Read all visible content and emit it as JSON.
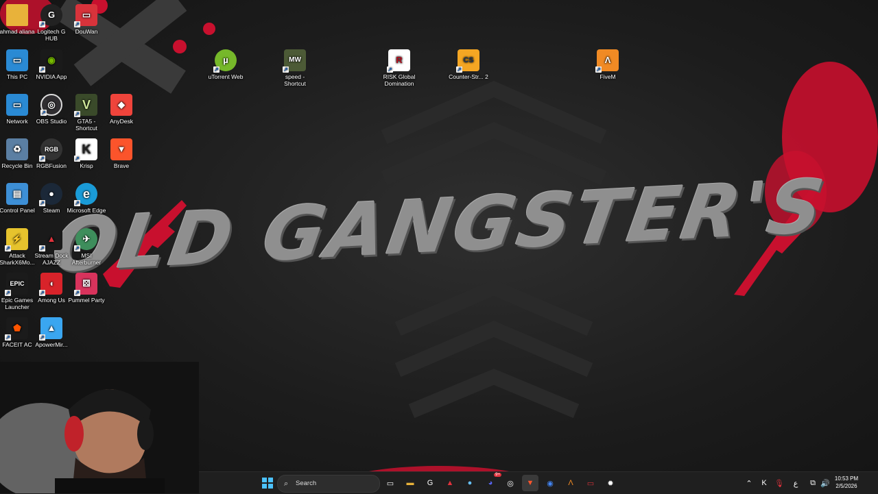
{
  "wallpaper": {
    "title": "OLD GANGSTER'S",
    "accent": "#c8102e"
  },
  "desktop_icons": [
    {
      "label": "ahmad aliana",
      "icon": "folder-icon",
      "color": "#e8b23a",
      "glyph": ""
    },
    {
      "label": "Logitech G HUB",
      "icon": "logitech-ghub-icon",
      "color": "#222222",
      "glyph": "G"
    },
    {
      "label": "DouWan",
      "icon": "douwan-icon",
      "color": "#d8333b",
      "glyph": "▭"
    },
    {
      "label": "This PC",
      "icon": "this-pc-icon",
      "color": "#2a8ad4",
      "glyph": "▭"
    },
    {
      "label": "NVIDIA App",
      "icon": "nvidia-icon",
      "color": "#1a1a1a",
      "glyph": "◉"
    },
    {
      "label": "uTorrent Web",
      "icon": "utorrent-icon",
      "color": "#76b82a",
      "glyph": "µ"
    },
    {
      "label": "speed - Shortcut",
      "icon": "nfs-mw-icon",
      "color": "#4c5a36",
      "glyph": "MW"
    },
    {
      "label": "RISK Global Domination",
      "icon": "risk-icon",
      "color": "#ffffff",
      "glyph": "R"
    },
    {
      "label": "Counter-Str... 2",
      "icon": "counter-strike-icon",
      "color": "#f5a623",
      "glyph": "CS"
    },
    {
      "label": "FiveM",
      "icon": "fivem-icon",
      "color": "#f08a24",
      "glyph": "Λ"
    },
    {
      "label": "Network",
      "icon": "network-icon",
      "color": "#2a8ad4",
      "glyph": "▭"
    },
    {
      "label": "OBS Studio",
      "icon": "obs-icon",
      "color": "#302e31",
      "glyph": "◎"
    },
    {
      "label": "GTA5 - Shortcut",
      "icon": "gta5-icon",
      "color": "#3a4a2a",
      "glyph": "V"
    },
    {
      "label": "AnyDesk",
      "icon": "anydesk-icon",
      "color": "#ef443b",
      "glyph": "◆"
    },
    {
      "label": "Recycle Bin",
      "icon": "recycle-bin-icon",
      "color": "#5b7fa3",
      "glyph": "♻"
    },
    {
      "label": "RGBFusion",
      "icon": "rgbfusion-icon",
      "color": "#333333",
      "glyph": "RGB"
    },
    {
      "label": "Krisp",
      "icon": "krisp-icon",
      "color": "#ffffff",
      "glyph": "K"
    },
    {
      "label": "Brave",
      "icon": "brave-icon",
      "color": "#fb542b",
      "glyph": "▼"
    },
    {
      "label": "Control Panel",
      "icon": "control-panel-icon",
      "color": "#3d8fd6",
      "glyph": "▤"
    },
    {
      "label": "Steam",
      "icon": "steam-icon",
      "color": "#1b2838",
      "glyph": "●"
    },
    {
      "label": "Microsoft Edge",
      "icon": "edge-icon",
      "color": "#1a9bd7",
      "glyph": "e"
    },
    {
      "label": "Attack SharkX6Mo...",
      "icon": "attack-shark-icon",
      "color": "#e6c32d",
      "glyph": "⚡"
    },
    {
      "label": "Stream Dock AJAZZ",
      "icon": "stream-dock-icon",
      "color": "#1a1a1a",
      "glyph": "▲"
    },
    {
      "label": "MSI Afterburner",
      "icon": "msi-afterburner-icon",
      "color": "#3e8e5c",
      "glyph": "✈"
    },
    {
      "label": "Epic Games Launcher",
      "icon": "epic-games-icon",
      "color": "#1b1b1b",
      "glyph": "EPIC"
    },
    {
      "label": "Among Us",
      "icon": "among-us-icon",
      "color": "#d8232a",
      "glyph": "◖"
    },
    {
      "label": "Pummel Party",
      "icon": "pummel-party-icon",
      "color": "#d8335c",
      "glyph": "⚄"
    },
    {
      "label": "FACEIT AC",
      "icon": "faceit-icon",
      "color": "#1b1b1b",
      "glyph": "⬟"
    },
    {
      "label": "ApowerMir...",
      "icon": "apowermirror-icon",
      "color": "#3aa6f0",
      "glyph": "▲"
    }
  ],
  "taskbar": {
    "search_placeholder": "Search",
    "apps": [
      {
        "icon": "task-view-icon",
        "color": "#ffffff",
        "glyph": "▭"
      },
      {
        "icon": "file-explorer-icon",
        "color": "#e8b23a",
        "glyph": "▬"
      },
      {
        "icon": "logitech-ghub-icon",
        "color": "#222222",
        "glyph": "G"
      },
      {
        "icon": "stream-dock-icon",
        "color": "#1a1a1a",
        "glyph": "▲"
      },
      {
        "icon": "steam-icon",
        "color": "#1b2838",
        "glyph": "●"
      },
      {
        "icon": "discord-icon",
        "color": "#5865f2",
        "glyph": "◕"
      },
      {
        "icon": "obs-icon",
        "color": "#302e31",
        "glyph": "◎"
      },
      {
        "icon": "brave-icon",
        "color": "#fb542b",
        "glyph": "▼"
      },
      {
        "icon": "chrome-icon",
        "color": "#4285f4",
        "glyph": "◉"
      },
      {
        "icon": "fivem-icon",
        "color": "#f08a24",
        "glyph": "Λ"
      },
      {
        "icon": "douwan-icon",
        "color": "#d8333b",
        "glyph": "▭"
      },
      {
        "icon": "steelseries-icon",
        "color": "#ffffff",
        "glyph": "✹"
      }
    ],
    "discord_badge": "9+",
    "tray": {
      "lang": "ع",
      "time": "10:53 PM",
      "date": "2/5/2026"
    }
  }
}
